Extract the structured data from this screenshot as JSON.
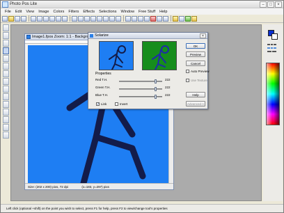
{
  "app": {
    "title": "Photo Pos Lite"
  },
  "menu": [
    "File",
    "Edit",
    "View",
    "Image",
    "Colors",
    "Filters",
    "Effects",
    "Selections",
    "Window",
    "Free Stuff",
    "Help"
  ],
  "document": {
    "title": "Image1.fpos   Zoom: 1:1 - Backgro",
    "status_size": "Size: (202 x 200) pixs, 72 dpi",
    "status_pos": "(x=183, y=297) pixs"
  },
  "dialog": {
    "title": "Solarize",
    "properties_label": "Properties",
    "rows": [
      {
        "label": "Red T.H.",
        "value": "222",
        "level": 0.87
      },
      {
        "label": "Green T.H.",
        "value": "222",
        "level": 0.87
      },
      {
        "label": "Blue T.H.",
        "value": "222",
        "level": 0.87
      }
    ],
    "link_label": "Link",
    "invert_label": "Invert",
    "buttons": {
      "ok": "OK",
      "preview": "Preview",
      "cancel": "Cancel",
      "help": "Help",
      "advanced": "Advanced >"
    },
    "auto_preview": "Auto Preview",
    "use_texture": "Use Texture"
  },
  "status": {
    "text": "Left click (optional +shift) on the point you wish to select, press F1 for help, press F2 to view/change tool's properties"
  },
  "colors": {
    "canvas": "#1e7ef3",
    "preview_after": "#168d1c",
    "stroke": "#131c4a",
    "stroke_after": "#1f2aa8"
  }
}
